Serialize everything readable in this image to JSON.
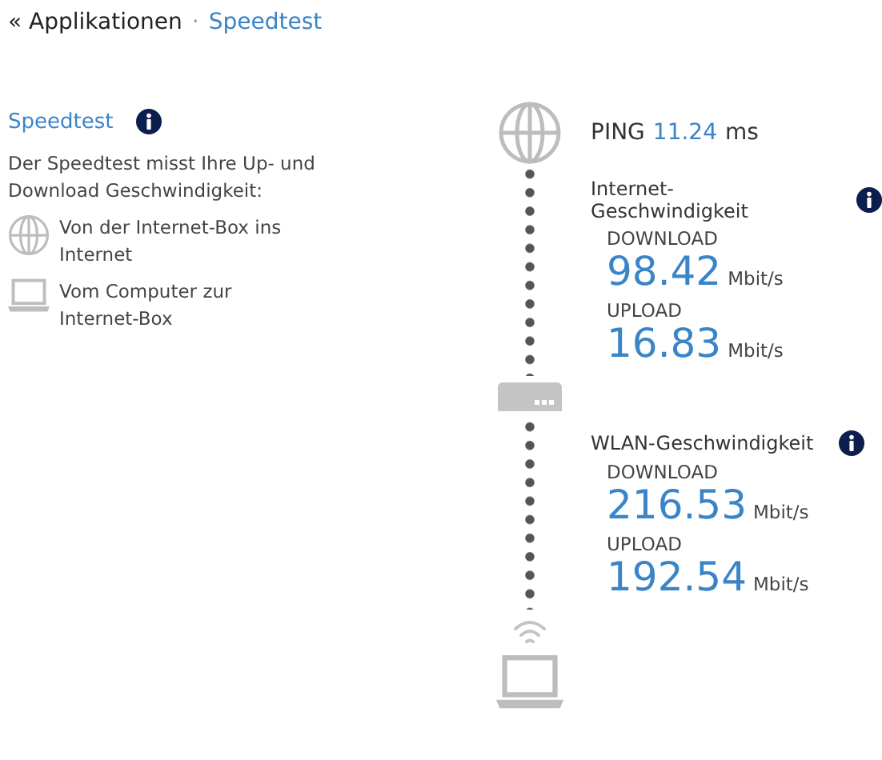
{
  "breadcrumb": {
    "back": "« Applikationen",
    "separator": "·",
    "current": "Speedtest"
  },
  "intro": {
    "title": "Speedtest",
    "description": "Der Speedtest misst Ihre Up- und Download Geschwindigkeit:",
    "items": [
      {
        "kind": "globe",
        "text": "Von der Internet-Box ins Internet"
      },
      {
        "kind": "laptop",
        "text": "Vom Computer zur Internet-Box"
      }
    ]
  },
  "ping": {
    "label": "PING",
    "value": "11.24",
    "unit": "ms"
  },
  "sections": [
    {
      "title": "Internet-Geschwindigkeit",
      "measurements": [
        {
          "label": "DOWNLOAD",
          "value": "98.42",
          "unit": "Mbit/s"
        },
        {
          "label": "UPLOAD",
          "value": "16.83",
          "unit": "Mbit/s"
        }
      ]
    },
    {
      "title": "WLAN-Geschwindigkeit",
      "measurements": [
        {
          "label": "DOWNLOAD",
          "value": "216.53",
          "unit": "Mbit/s"
        },
        {
          "label": "UPLOAD",
          "value": "192.54",
          "unit": "Mbit/s"
        }
      ]
    }
  ]
}
